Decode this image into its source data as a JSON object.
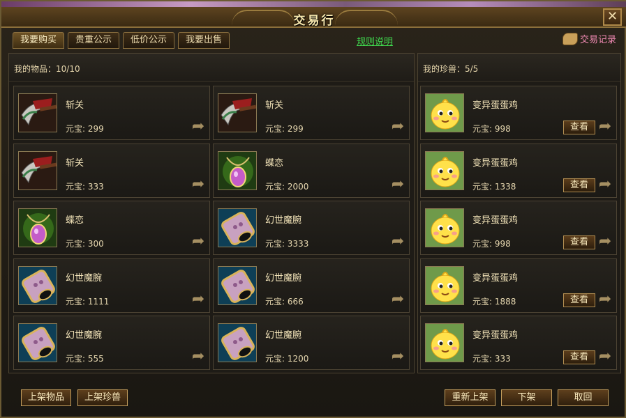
{
  "window": {
    "title": "交易行",
    "close_label": "✕"
  },
  "tabs": [
    {
      "label": "我要购买"
    },
    {
      "label": "贵重公示"
    },
    {
      "label": "低价公示"
    },
    {
      "label": "我要出售"
    }
  ],
  "rules_link": "规则说明",
  "trade_log_label": "交易记录",
  "items_panel": {
    "header": "我的物品：10/10",
    "items": [
      {
        "name": "斩关",
        "price": "元宝: 299",
        "icon": "axe-icon"
      },
      {
        "name": "斩关",
        "price": "元宝: 299",
        "icon": "axe-icon"
      },
      {
        "name": "斩关",
        "price": "元宝: 333",
        "icon": "axe-icon"
      },
      {
        "name": "蝶恋",
        "price": "元宝: 2000",
        "icon": "necklace-icon"
      },
      {
        "name": "蝶恋",
        "price": "元宝: 300",
        "icon": "necklace-icon"
      },
      {
        "name": "幻世魔腕",
        "price": "元宝: 3333",
        "icon": "bracelet-icon"
      },
      {
        "name": "幻世魔腕",
        "price": "元宝: 1111",
        "icon": "bracelet-icon"
      },
      {
        "name": "幻世魔腕",
        "price": "元宝: 666",
        "icon": "bracelet-icon"
      },
      {
        "name": "幻世魔腕",
        "price": "元宝: 555",
        "icon": "bracelet-icon"
      },
      {
        "name": "幻世魔腕",
        "price": "元宝: 1200",
        "icon": "bracelet-icon"
      }
    ]
  },
  "pets_panel": {
    "header": "我的珍兽：5/5",
    "view_label": "查看",
    "pets": [
      {
        "name": "变异蛋蛋鸡",
        "price": "元宝: 998",
        "icon": "chick-icon"
      },
      {
        "name": "变异蛋蛋鸡",
        "price": "元宝: 1338",
        "icon": "chick-icon"
      },
      {
        "name": "变异蛋蛋鸡",
        "price": "元宝: 998",
        "icon": "chick-icon"
      },
      {
        "name": "变异蛋蛋鸡",
        "price": "元宝: 1888",
        "icon": "chick-icon"
      },
      {
        "name": "变异蛋蛋鸡",
        "price": "元宝: 333",
        "icon": "chick-icon"
      }
    ]
  },
  "footer": {
    "list_item": "上架物品",
    "list_pet": "上架珍兽",
    "relist": "重新上架",
    "delist": "下架",
    "cancel": "取回"
  }
}
